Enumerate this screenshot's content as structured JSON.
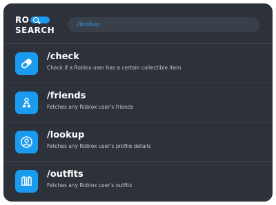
{
  "app": {
    "logo_top": "RO",
    "logo_bottom": "SEARCH"
  },
  "search": {
    "value": "/lookup"
  },
  "commands": [
    {
      "name": "/check",
      "description": "Check if a Roblox user has a certain collectible item",
      "icon": "pill-icon"
    },
    {
      "name": "/friends",
      "description": "Fetches any Roblox user's friends",
      "icon": "friends-icon"
    },
    {
      "name": "/lookup",
      "description": "Fetches any Roblox user's profile details",
      "icon": "user-circle-icon"
    },
    {
      "name": "/outfits",
      "description": "Fetches any Roblox user's outfits",
      "icon": "shirt-icon"
    }
  ],
  "colors": {
    "background": "#2c313a",
    "accent": "#1a9bf0",
    "search_text": "#2f9ef5"
  }
}
